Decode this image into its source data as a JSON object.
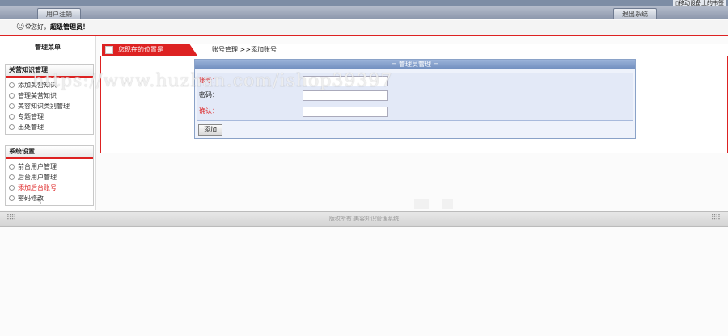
{
  "header": {
    "top_link": "▯移动设备上的书签",
    "tab_left": "用户注销",
    "tab_right": "退出系统",
    "greeting_prefix": "您好，",
    "greeting_user": "超级管理员！"
  },
  "sidebar": {
    "title": "管理菜单",
    "panels": [
      {
        "heading": "关营知识管理",
        "items": [
          "添加美营知识",
          "管理美营知识",
          "美容知识类别管理",
          "专题管理",
          "出处管理"
        ]
      },
      {
        "heading": "系统设置",
        "items": [
          "前台用户管理",
          "后台用户管理",
          "添加后台账号",
          "密码修改"
        ]
      }
    ]
  },
  "main": {
    "location_label": "您现在的位置是",
    "breadcrumb": "账号管理 >>添加账号"
  },
  "form": {
    "heading": "= 管理员管理 =",
    "fields": [
      {
        "label": "账号：",
        "value": ""
      },
      {
        "label": "密码：",
        "value": ""
      },
      {
        "label": "确认：",
        "value": ""
      }
    ],
    "submit_label": "添加"
  },
  "footer": {
    "copyright": "版权所有 美容知识管理系统"
  },
  "watermark": "https://www.huzhan.com/ishop39397"
}
